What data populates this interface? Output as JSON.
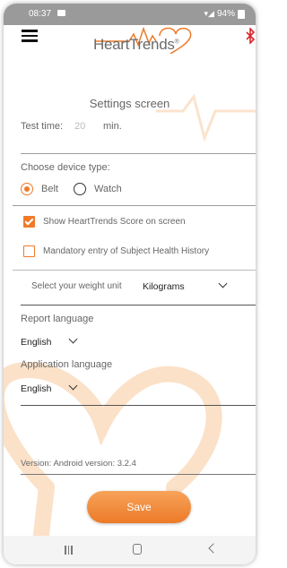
{
  "status_bar": {
    "time": "08:37",
    "battery": "94%"
  },
  "header": {
    "logo_text": "HeartTrends",
    "logo_reg": "®"
  },
  "screen_title": "Settings screen",
  "test_time": {
    "label": "Test time:",
    "value": "20",
    "unit": "min."
  },
  "device_type": {
    "label": "Choose device type:",
    "options": [
      {
        "label": "Belt",
        "selected": true
      },
      {
        "label": "Watch",
        "selected": false
      }
    ]
  },
  "checkboxes": [
    {
      "label": "Show HeartTrends Score on screen",
      "checked": true
    },
    {
      "label": "Mandatory entry of Subject Health History",
      "checked": false
    }
  ],
  "weight_unit": {
    "label": "Select your weight unit",
    "value": "Kilograms"
  },
  "report_language": {
    "label": "Report language",
    "value": "English"
  },
  "application_language": {
    "label": "Application language",
    "value": "English"
  },
  "version": "Version: Android version: 3.2.4",
  "save_label": "Save",
  "colors": {
    "accent": "#ef7a2a",
    "accent_light": "#f7a35a",
    "status_bar": "#9a9a9a"
  },
  "nav_icons": [
    "recent-apps-icon",
    "home-icon",
    "back-icon"
  ]
}
